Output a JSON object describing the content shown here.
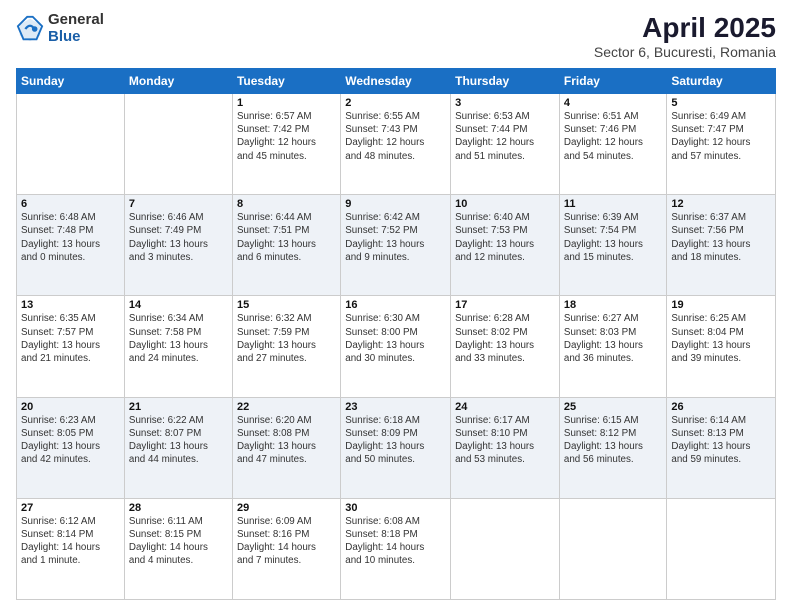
{
  "logo": {
    "general": "General",
    "blue": "Blue"
  },
  "title": "April 2025",
  "subtitle": "Sector 6, Bucuresti, Romania",
  "weekdays": [
    "Sunday",
    "Monday",
    "Tuesday",
    "Wednesday",
    "Thursday",
    "Friday",
    "Saturday"
  ],
  "weeks": [
    [
      {
        "day": "",
        "detail": ""
      },
      {
        "day": "",
        "detail": ""
      },
      {
        "day": "1",
        "detail": "Sunrise: 6:57 AM\nSunset: 7:42 PM\nDaylight: 12 hours\nand 45 minutes."
      },
      {
        "day": "2",
        "detail": "Sunrise: 6:55 AM\nSunset: 7:43 PM\nDaylight: 12 hours\nand 48 minutes."
      },
      {
        "day": "3",
        "detail": "Sunrise: 6:53 AM\nSunset: 7:44 PM\nDaylight: 12 hours\nand 51 minutes."
      },
      {
        "day": "4",
        "detail": "Sunrise: 6:51 AM\nSunset: 7:46 PM\nDaylight: 12 hours\nand 54 minutes."
      },
      {
        "day": "5",
        "detail": "Sunrise: 6:49 AM\nSunset: 7:47 PM\nDaylight: 12 hours\nand 57 minutes."
      }
    ],
    [
      {
        "day": "6",
        "detail": "Sunrise: 6:48 AM\nSunset: 7:48 PM\nDaylight: 13 hours\nand 0 minutes."
      },
      {
        "day": "7",
        "detail": "Sunrise: 6:46 AM\nSunset: 7:49 PM\nDaylight: 13 hours\nand 3 minutes."
      },
      {
        "day": "8",
        "detail": "Sunrise: 6:44 AM\nSunset: 7:51 PM\nDaylight: 13 hours\nand 6 minutes."
      },
      {
        "day": "9",
        "detail": "Sunrise: 6:42 AM\nSunset: 7:52 PM\nDaylight: 13 hours\nand 9 minutes."
      },
      {
        "day": "10",
        "detail": "Sunrise: 6:40 AM\nSunset: 7:53 PM\nDaylight: 13 hours\nand 12 minutes."
      },
      {
        "day": "11",
        "detail": "Sunrise: 6:39 AM\nSunset: 7:54 PM\nDaylight: 13 hours\nand 15 minutes."
      },
      {
        "day": "12",
        "detail": "Sunrise: 6:37 AM\nSunset: 7:56 PM\nDaylight: 13 hours\nand 18 minutes."
      }
    ],
    [
      {
        "day": "13",
        "detail": "Sunrise: 6:35 AM\nSunset: 7:57 PM\nDaylight: 13 hours\nand 21 minutes."
      },
      {
        "day": "14",
        "detail": "Sunrise: 6:34 AM\nSunset: 7:58 PM\nDaylight: 13 hours\nand 24 minutes."
      },
      {
        "day": "15",
        "detail": "Sunrise: 6:32 AM\nSunset: 7:59 PM\nDaylight: 13 hours\nand 27 minutes."
      },
      {
        "day": "16",
        "detail": "Sunrise: 6:30 AM\nSunset: 8:00 PM\nDaylight: 13 hours\nand 30 minutes."
      },
      {
        "day": "17",
        "detail": "Sunrise: 6:28 AM\nSunset: 8:02 PM\nDaylight: 13 hours\nand 33 minutes."
      },
      {
        "day": "18",
        "detail": "Sunrise: 6:27 AM\nSunset: 8:03 PM\nDaylight: 13 hours\nand 36 minutes."
      },
      {
        "day": "19",
        "detail": "Sunrise: 6:25 AM\nSunset: 8:04 PM\nDaylight: 13 hours\nand 39 minutes."
      }
    ],
    [
      {
        "day": "20",
        "detail": "Sunrise: 6:23 AM\nSunset: 8:05 PM\nDaylight: 13 hours\nand 42 minutes."
      },
      {
        "day": "21",
        "detail": "Sunrise: 6:22 AM\nSunset: 8:07 PM\nDaylight: 13 hours\nand 44 minutes."
      },
      {
        "day": "22",
        "detail": "Sunrise: 6:20 AM\nSunset: 8:08 PM\nDaylight: 13 hours\nand 47 minutes."
      },
      {
        "day": "23",
        "detail": "Sunrise: 6:18 AM\nSunset: 8:09 PM\nDaylight: 13 hours\nand 50 minutes."
      },
      {
        "day": "24",
        "detail": "Sunrise: 6:17 AM\nSunset: 8:10 PM\nDaylight: 13 hours\nand 53 minutes."
      },
      {
        "day": "25",
        "detail": "Sunrise: 6:15 AM\nSunset: 8:12 PM\nDaylight: 13 hours\nand 56 minutes."
      },
      {
        "day": "26",
        "detail": "Sunrise: 6:14 AM\nSunset: 8:13 PM\nDaylight: 13 hours\nand 59 minutes."
      }
    ],
    [
      {
        "day": "27",
        "detail": "Sunrise: 6:12 AM\nSunset: 8:14 PM\nDaylight: 14 hours\nand 1 minute."
      },
      {
        "day": "28",
        "detail": "Sunrise: 6:11 AM\nSunset: 8:15 PM\nDaylight: 14 hours\nand 4 minutes."
      },
      {
        "day": "29",
        "detail": "Sunrise: 6:09 AM\nSunset: 8:16 PM\nDaylight: 14 hours\nand 7 minutes."
      },
      {
        "day": "30",
        "detail": "Sunrise: 6:08 AM\nSunset: 8:18 PM\nDaylight: 14 hours\nand 10 minutes."
      },
      {
        "day": "",
        "detail": ""
      },
      {
        "day": "",
        "detail": ""
      },
      {
        "day": "",
        "detail": ""
      }
    ]
  ]
}
